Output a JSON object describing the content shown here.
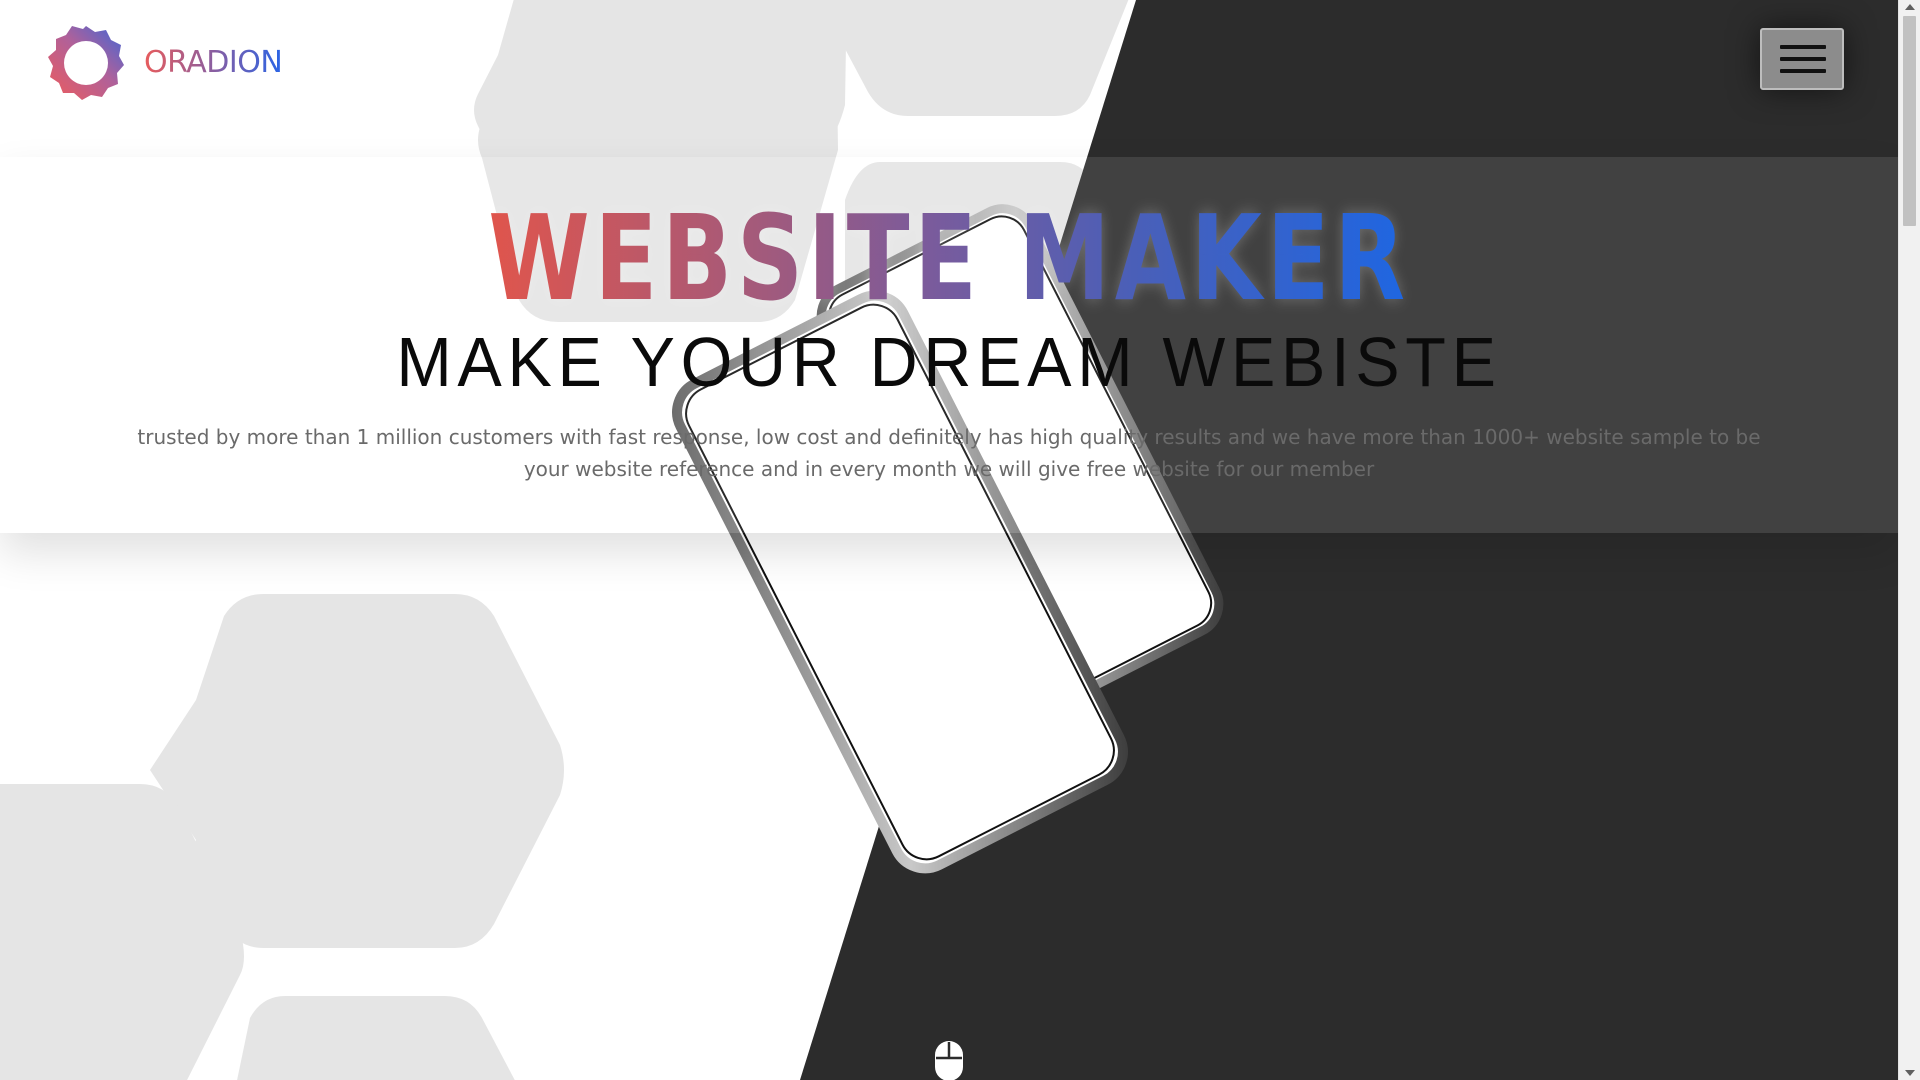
{
  "brand": {
    "name": "ORADION",
    "logo_icon": "ring-gear-logo-icon"
  },
  "header": {
    "menu_icon": "hamburger-menu-icon"
  },
  "hero": {
    "title": "WEBSITE MAKER",
    "subtitle": "MAKE YOUR DREAM WEBISTE",
    "description": "trusted by more than 1 million customers with fast response, low cost and definitely has high quality results and we have more than 1000+ website sample to be your website reference and in every month we will give free website for our member",
    "image_icon": "phone-mockup-image"
  },
  "scroll_indicator": {
    "icon": "mouse-scroll-icon"
  },
  "colors": {
    "dark_panel": "#2c2c2c",
    "hexagon": "#e5e5e5",
    "gradient_start": "#e0554c",
    "gradient_end": "#1e66e2",
    "description_text": "#6a6a6a"
  }
}
